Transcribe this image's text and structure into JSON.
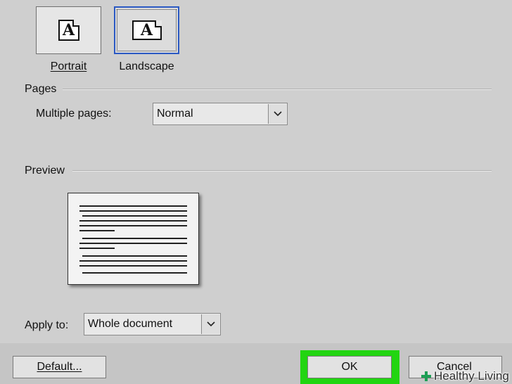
{
  "orientation": {
    "portrait_label": "Portrait",
    "landscape_label": "Landscape",
    "selected": "Landscape"
  },
  "pages": {
    "section_label": "Pages",
    "multiple_pages_label": "Multiple pages:",
    "multiple_pages_value": "Normal"
  },
  "preview": {
    "section_label": "Preview"
  },
  "apply": {
    "label": "Apply to:",
    "value": "Whole document"
  },
  "buttons": {
    "default_label": "Default...",
    "ok_label": "OK",
    "cancel_label": "Cancel"
  },
  "watermark": {
    "text": "Healthy Living"
  },
  "colors": {
    "highlight": "#22d511",
    "selection_border": "#2b59c3"
  }
}
